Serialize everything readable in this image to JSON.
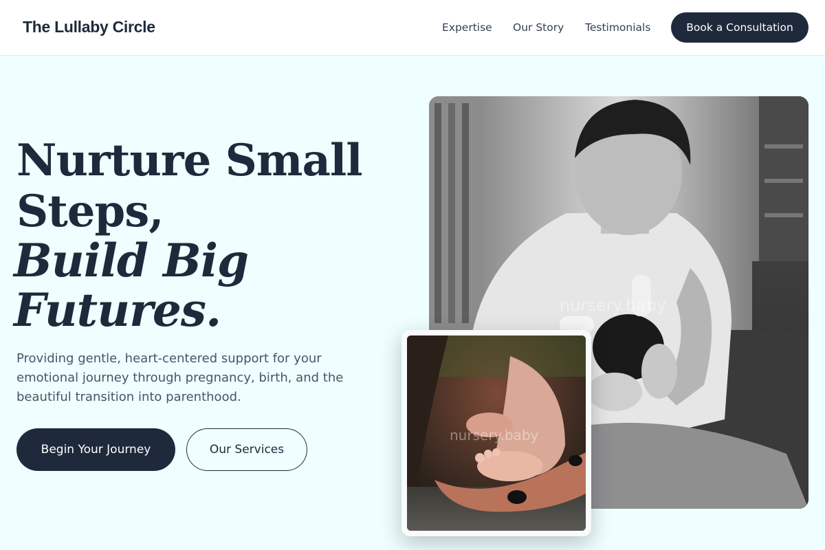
{
  "nav": {
    "brand": "The Lullaby Circle",
    "links": [
      "Expertise",
      "Our Story",
      "Testimonials"
    ],
    "cta": "Book a Consultation"
  },
  "hero": {
    "headline_line1": "Nurture Small",
    "headline_line2": "Steps,",
    "headline_italic1": "Build Big",
    "headline_italic2": "Futures.",
    "lead": "Providing gentle, heart-centered support for your emotional journey through pregnancy, birth, and the beautiful transition into parenthood.",
    "primary_button": "Begin Your Journey",
    "secondary_button": "Our Services"
  },
  "images": {
    "main_watermark": "nursery.baby",
    "small_watermark": "nursery.baby"
  },
  "colors": {
    "navy": "#1e293b",
    "hero_bg": "#effefe",
    "body_text": "#475569"
  }
}
